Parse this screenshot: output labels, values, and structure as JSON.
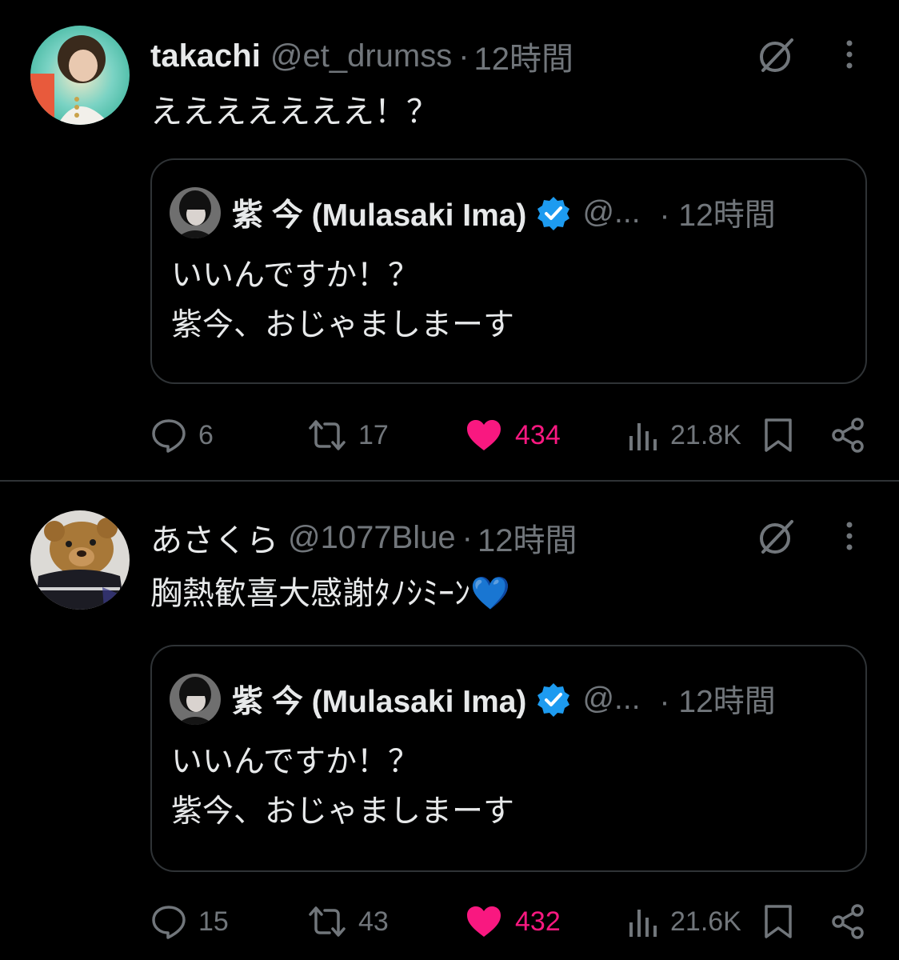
{
  "colors": {
    "background": "#000000",
    "text_primary": "#e7e9ea",
    "text_secondary": "#71767b",
    "border": "#2f3336",
    "like_active": "#f91880",
    "verified": "#1d9bf0"
  },
  "posts": [
    {
      "display_name": "takachi",
      "handle": "@et_drumss",
      "separator": "·",
      "time": "12時間",
      "text": "えええええええ！？",
      "quote": {
        "display_name": "紫 今 (Mulasaki Ima)",
        "handle": "@...",
        "separator": "·",
        "time": "12時間",
        "text": "いいんですか！？\n紫今、おじゃましまーす"
      },
      "actions": {
        "replies": "6",
        "reposts": "17",
        "likes": "434",
        "views": "21.8K"
      },
      "liked": true
    },
    {
      "display_name": "あさくら",
      "handle": "@1077Blue",
      "separator": "·",
      "time": "12時間",
      "text": "胸熱歓喜大感謝ﾀﾉｼﾐｰﾝ💙",
      "quote": {
        "display_name": "紫 今 (Mulasaki Ima)",
        "handle": "@...",
        "separator": "·",
        "time": "12時間",
        "text": "いいんですか！？\n紫今、おじゃましまーす"
      },
      "actions": {
        "replies": "15",
        "reposts": "43",
        "likes": "432",
        "views": "21.6K"
      },
      "liked": true
    }
  ],
  "icons": {
    "header": [
      "grok-icon",
      "more-icon"
    ],
    "actions": [
      "reply-icon",
      "repost-icon",
      "like-icon",
      "views-icon",
      "bookmark-icon",
      "share-icon"
    ],
    "quote": [
      "verified-badge-icon"
    ]
  }
}
